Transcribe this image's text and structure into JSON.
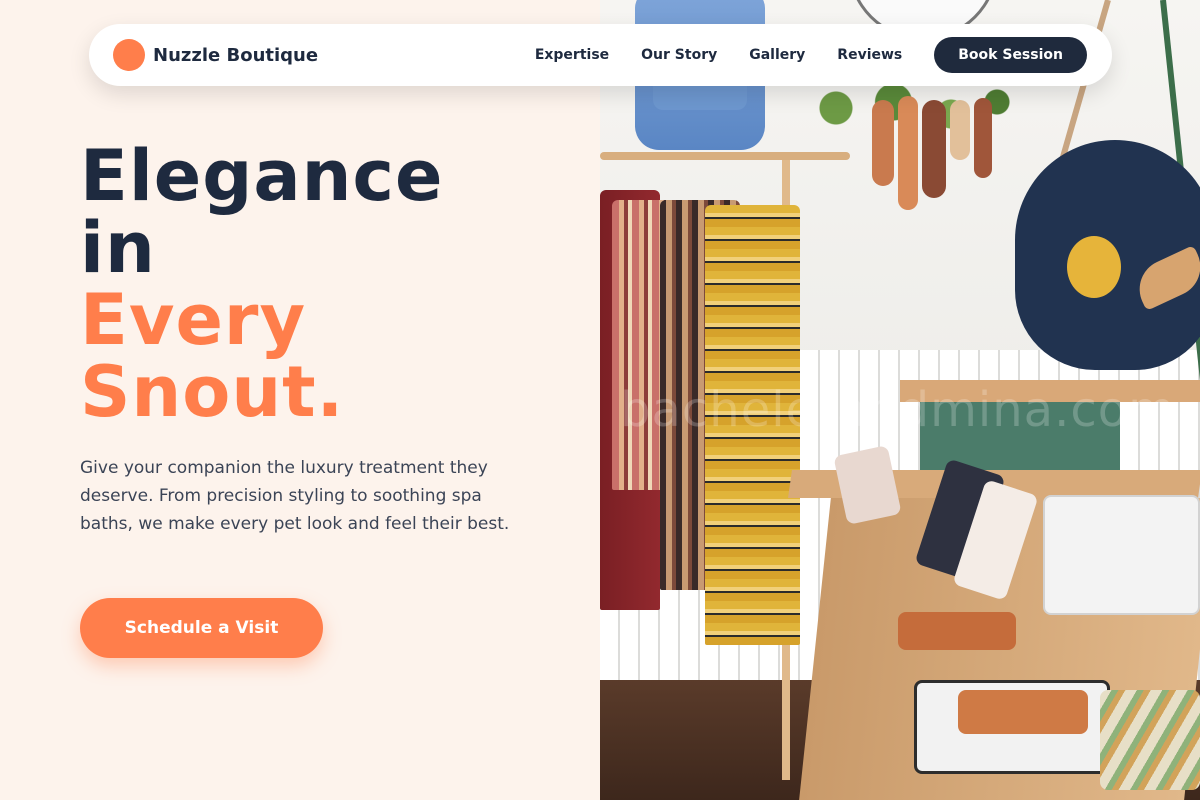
{
  "brand": {
    "name": "Nuzzle Boutique",
    "logo_color": "#ff7e4b"
  },
  "nav": {
    "links": [
      "Expertise",
      "Our Story",
      "Gallery",
      "Reviews"
    ],
    "cta_label": "Book Session"
  },
  "hero": {
    "title_line1": "Elegance",
    "title_line2": "in",
    "title_accent_line1": "Every",
    "title_accent_line2": "Snout.",
    "description": "Give your companion the luxury treatment they deserve. From precision styling to soothing spa baths, we make every pet look and feel their best.",
    "cta_label": "Schedule a Visit"
  },
  "photo": {
    "watermark": "bachelerandmina.com"
  },
  "colors": {
    "accent": "#ff7e4b",
    "dark": "#1e2a3f",
    "background": "#fdf3ec"
  }
}
